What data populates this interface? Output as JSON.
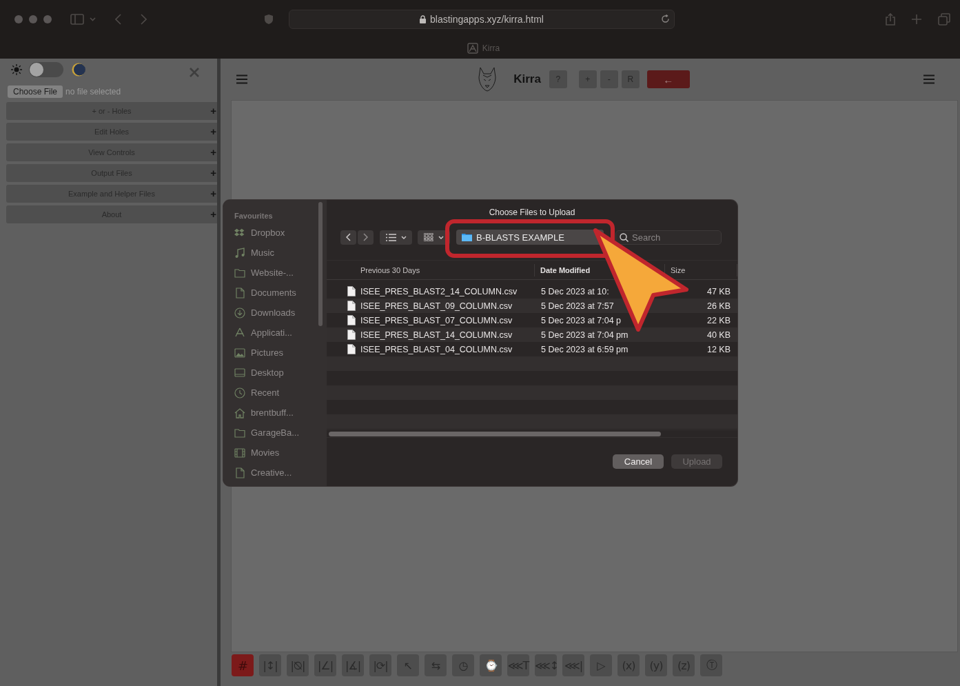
{
  "browser": {
    "url": "blastingapps.xyz/kirra.html",
    "tab_title": "Kirra"
  },
  "sidebar": {
    "theme_toggle": {
      "on": false
    },
    "file_button": "Choose File",
    "file_status": "no file selected",
    "sections": [
      {
        "label": "+ or - Holes",
        "expand": "+"
      },
      {
        "label": "Edit Holes",
        "expand": "+"
      },
      {
        "label": "View Controls",
        "expand": "+"
      },
      {
        "label": "Output Files",
        "expand": "+"
      },
      {
        "label": "Example and Helper Files",
        "expand": "+"
      },
      {
        "label": "About",
        "expand": "+"
      }
    ]
  },
  "header": {
    "title": "Kirra",
    "buttons": [
      {
        "label": "?",
        "kind": "plain"
      },
      {
        "label": "+",
        "kind": "plain"
      },
      {
        "label": "-",
        "kind": "plain"
      },
      {
        "label": "R",
        "kind": "plain"
      },
      {
        "label": "←",
        "kind": "danger"
      }
    ]
  },
  "toolbar": [
    {
      "label": "#",
      "selected": true
    },
    {
      "label": "|↕|",
      "selected": false
    },
    {
      "label": "|⦰|",
      "selected": false
    },
    {
      "label": "|∠|",
      "selected": false
    },
    {
      "label": "|∡|",
      "selected": false
    },
    {
      "label": "|⟳|",
      "selected": false
    },
    {
      "label": "↖",
      "selected": false
    },
    {
      "label": "⇆",
      "selected": false
    },
    {
      "label": "◷",
      "selected": false
    },
    {
      "label": "⌚",
      "selected": false
    },
    {
      "label": "⋘T",
      "selected": false
    },
    {
      "label": "⋘↕",
      "selected": false
    },
    {
      "label": "⋘|",
      "selected": false
    },
    {
      "label": "▷",
      "selected": false
    },
    {
      "label": "(x)",
      "selected": false
    },
    {
      "label": "(y)",
      "selected": false
    },
    {
      "label": "(z)",
      "selected": false
    },
    {
      "label": "Ⓣ",
      "selected": false
    }
  ],
  "dialog": {
    "title": "Choose Files to Upload",
    "location": "B-BLASTS EXAMPLE",
    "search": {
      "placeholder": "Search"
    },
    "sidebar": {
      "heading": "Favourites",
      "items": [
        {
          "label": "Dropbox",
          "kind": "dropbox"
        },
        {
          "label": "Music",
          "kind": "music"
        },
        {
          "label": "Website-...",
          "kind": "folder"
        },
        {
          "label": "Documents",
          "kind": "document"
        },
        {
          "label": "Downloads",
          "kind": "download"
        },
        {
          "label": "Applicati...",
          "kind": "apps"
        },
        {
          "label": "Pictures",
          "kind": "picture"
        },
        {
          "label": "Desktop",
          "kind": "desktop"
        },
        {
          "label": "Recent",
          "kind": "recent"
        },
        {
          "label": "brentbuff...",
          "kind": "home"
        },
        {
          "label": "GarageBa...",
          "kind": "folder"
        },
        {
          "label": "Movies",
          "kind": "movies"
        },
        {
          "label": "Creative...",
          "kind": "document"
        }
      ]
    },
    "columns": [
      "Previous 30 Days",
      "Date Modified",
      "Size"
    ],
    "rows": [
      {
        "name": "ISEE_PRES_BLAST2_14_COLUMN.csv",
        "date": "5 Dec 2023 at 10:",
        "size": "47 KB"
      },
      {
        "name": "ISEE_PRES_BLAST_09_COLUMN.csv",
        "date": "5 Dec 2023 at 7:57",
        "size": "26 KB"
      },
      {
        "name": "ISEE_PRES_BLAST_07_COLUMN.csv",
        "date": "5 Dec 2023 at 7:04 p",
        "size": "22 KB"
      },
      {
        "name": "ISEE_PRES_BLAST_14_COLUMN.csv",
        "date": "5 Dec 2023 at 7:04 pm",
        "size": "40 KB"
      },
      {
        "name": "ISEE_PRES_BLAST_04_COLUMN.csv",
        "date": "5 Dec 2023 at 6:59 pm",
        "size": "12 KB"
      }
    ],
    "buttons": [
      {
        "label": "Cancel",
        "disabled": false
      },
      {
        "label": "Upload",
        "disabled": true
      }
    ]
  }
}
